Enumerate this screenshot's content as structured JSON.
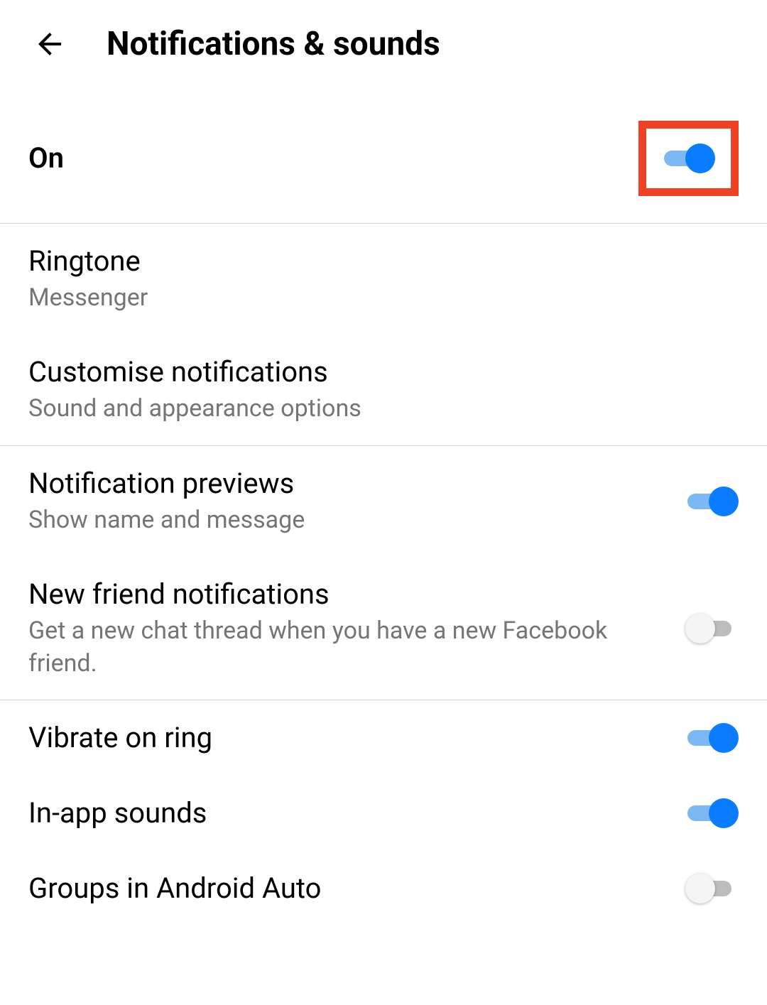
{
  "header": {
    "title": "Notifications & sounds"
  },
  "master_toggle": {
    "label": "On",
    "state": "on"
  },
  "sections": [
    {
      "rows": [
        {
          "title": "Ringtone",
          "subtitle": "Messenger",
          "type": "link"
        },
        {
          "title": "Customise notifications",
          "subtitle": "Sound and appearance options",
          "type": "link"
        }
      ]
    },
    {
      "rows": [
        {
          "title": "Notification previews",
          "subtitle": "Show name and message",
          "type": "toggle",
          "state": "on"
        },
        {
          "title": "New friend notifications",
          "subtitle": "Get a new chat thread when you have a new Facebook friend.",
          "type": "toggle",
          "state": "off"
        }
      ]
    },
    {
      "rows": [
        {
          "title": "Vibrate on ring",
          "subtitle": "",
          "type": "toggle",
          "state": "on"
        },
        {
          "title": "In-app sounds",
          "subtitle": "",
          "type": "toggle",
          "state": "on"
        },
        {
          "title": "Groups in Android Auto",
          "subtitle": "",
          "type": "toggle",
          "state": "off"
        }
      ]
    }
  ]
}
